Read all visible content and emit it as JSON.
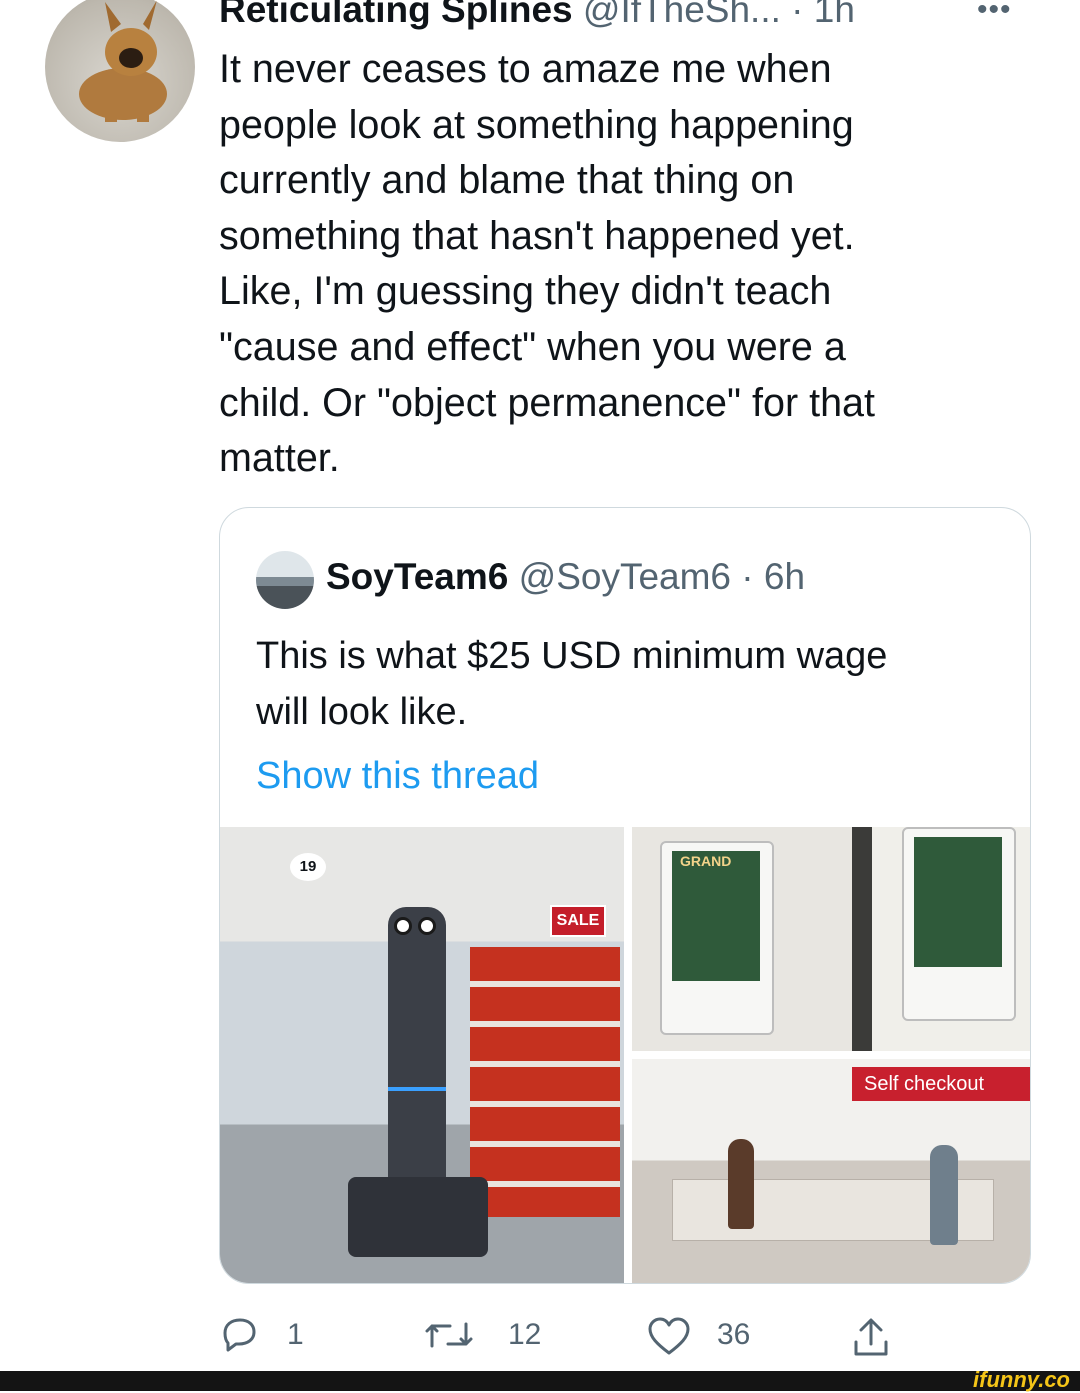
{
  "tweet": {
    "author_name": "Reticulating Splines",
    "author_handle": "@IfTheSh...",
    "time": "· 1h",
    "more": "•••",
    "text": "It never ceases to amaze me when\npeople look at something happening\ncurrently and blame that thing on\nsomething that hasn't happened yet.\nLike, I'm guessing they didn't teach\n\"cause and effect\" when you were a\nchild. Or \"object permanence\" for that\nmatter."
  },
  "quote": {
    "author_name": "SoyTeam6",
    "author_handle": "@SoyTeam6",
    "time": "· 6h",
    "text": "This is what $25 USD minimum wage\nwill look like.",
    "show_thread": "Show this thread",
    "images": {
      "store_sale_sign": "SALE",
      "store_aisle_number": "19",
      "kiosk_banner": "GRAND",
      "self_checkout_sign": "Self checkout"
    }
  },
  "actions": {
    "replies": "1",
    "retweets": "12",
    "likes": "36"
  },
  "watermark": "ifunny.co",
  "icons": [
    "reply-icon",
    "retweet-icon",
    "like-icon",
    "share-icon",
    "more-icon"
  ]
}
